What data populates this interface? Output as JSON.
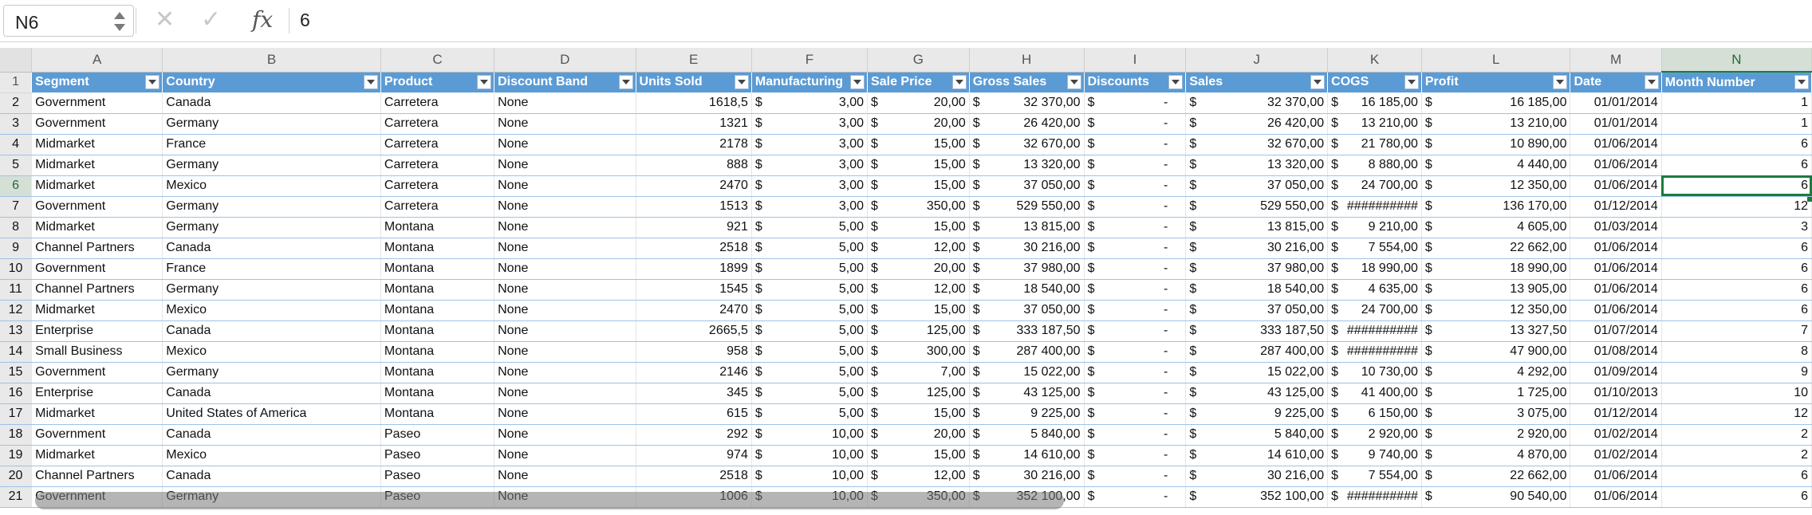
{
  "formula_bar": {
    "name_box": "N6",
    "cancel_icon": "✕",
    "enter_icon": "✓",
    "fx_label": "fx",
    "formula": "6"
  },
  "columns": [
    "A",
    "B",
    "C",
    "D",
    "E",
    "F",
    "G",
    "H",
    "I",
    "J",
    "K",
    "L",
    "M",
    "N"
  ],
  "headers": [
    "Segment",
    "Country",
    "Product",
    "Discount Band",
    "Units Sold",
    "Manufacturing",
    "Sale Price",
    "Gross Sales",
    "Discounts",
    "Sales",
    "COGS",
    "Profit",
    "Date",
    "Month Number"
  ],
  "header_row_number": "1",
  "rows": [
    {
      "n": "2",
      "cells": [
        "Government",
        "Canada",
        "Carretera",
        "None",
        "1618,5",
        "3,00",
        "20,00",
        "32 370,00",
        "-",
        "32 370,00",
        "16 185,00",
        "16 185,00",
        "01/01/2014",
        "1"
      ]
    },
    {
      "n": "3",
      "cells": [
        "Government",
        "Germany",
        "Carretera",
        "None",
        "1321",
        "3,00",
        "20,00",
        "26 420,00",
        "-",
        "26 420,00",
        "13 210,00",
        "13 210,00",
        "01/01/2014",
        "1"
      ]
    },
    {
      "n": "4",
      "cells": [
        "Midmarket",
        "France",
        "Carretera",
        "None",
        "2178",
        "3,00",
        "15,00",
        "32 670,00",
        "-",
        "32 670,00",
        "21 780,00",
        "10 890,00",
        "01/06/2014",
        "6"
      ]
    },
    {
      "n": "5",
      "cells": [
        "Midmarket",
        "Germany",
        "Carretera",
        "None",
        "888",
        "3,00",
        "15,00",
        "13 320,00",
        "-",
        "13 320,00",
        "8 880,00",
        "4 440,00",
        "01/06/2014",
        "6"
      ]
    },
    {
      "n": "6",
      "cells": [
        "Midmarket",
        "Mexico",
        "Carretera",
        "None",
        "2470",
        "3,00",
        "15,00",
        "37 050,00",
        "-",
        "37 050,00",
        "24 700,00",
        "12 350,00",
        "01/06/2014",
        "6"
      ]
    },
    {
      "n": "7",
      "cells": [
        "Government",
        "Germany",
        "Carretera",
        "None",
        "1513",
        "3,00",
        "350,00",
        "529 550,00",
        "-",
        "529 550,00",
        "##########",
        "136 170,00",
        "01/12/2014",
        "12"
      ]
    },
    {
      "n": "8",
      "cells": [
        "Midmarket",
        "Germany",
        "Montana",
        "None",
        "921",
        "5,00",
        "15,00",
        "13 815,00",
        "-",
        "13 815,00",
        "9 210,00",
        "4 605,00",
        "01/03/2014",
        "3"
      ]
    },
    {
      "n": "9",
      "cells": [
        "Channel Partners",
        "Canada",
        "Montana",
        "None",
        "2518",
        "5,00",
        "12,00",
        "30 216,00",
        "-",
        "30 216,00",
        "7 554,00",
        "22 662,00",
        "01/06/2014",
        "6"
      ]
    },
    {
      "n": "10",
      "cells": [
        "Government",
        "France",
        "Montana",
        "None",
        "1899",
        "5,00",
        "20,00",
        "37 980,00",
        "-",
        "37 980,00",
        "18 990,00",
        "18 990,00",
        "01/06/2014",
        "6"
      ]
    },
    {
      "n": "11",
      "cells": [
        "Channel Partners",
        "Germany",
        "Montana",
        "None",
        "1545",
        "5,00",
        "12,00",
        "18 540,00",
        "-",
        "18 540,00",
        "4 635,00",
        "13 905,00",
        "01/06/2014",
        "6"
      ]
    },
    {
      "n": "12",
      "cells": [
        "Midmarket",
        "Mexico",
        "Montana",
        "None",
        "2470",
        "5,00",
        "15,00",
        "37 050,00",
        "-",
        "37 050,00",
        "24 700,00",
        "12 350,00",
        "01/06/2014",
        "6"
      ]
    },
    {
      "n": "13",
      "cells": [
        "Enterprise",
        "Canada",
        "Montana",
        "None",
        "2665,5",
        "5,00",
        "125,00",
        "333 187,50",
        "-",
        "333 187,50",
        "##########",
        "13 327,50",
        "01/07/2014",
        "7"
      ]
    },
    {
      "n": "14",
      "cells": [
        "Small Business",
        "Mexico",
        "Montana",
        "None",
        "958",
        "5,00",
        "300,00",
        "287 400,00",
        "-",
        "287 400,00",
        "##########",
        "47 900,00",
        "01/08/2014",
        "8"
      ]
    },
    {
      "n": "15",
      "cells": [
        "Government",
        "Germany",
        "Montana",
        "None",
        "2146",
        "5,00",
        "7,00",
        "15 022,00",
        "-",
        "15 022,00",
        "10 730,00",
        "4 292,00",
        "01/09/2014",
        "9"
      ]
    },
    {
      "n": "16",
      "cells": [
        "Enterprise",
        "Canada",
        "Montana",
        "None",
        "345",
        "5,00",
        "125,00",
        "43 125,00",
        "-",
        "43 125,00",
        "41 400,00",
        "1 725,00",
        "01/10/2013",
        "10"
      ]
    },
    {
      "n": "17",
      "cells": [
        "Midmarket",
        "United States of America",
        "Montana",
        "None",
        "615",
        "5,00",
        "15,00",
        "9 225,00",
        "-",
        "9 225,00",
        "6 150,00",
        "3 075,00",
        "01/12/2014",
        "12"
      ]
    },
    {
      "n": "18",
      "cells": [
        "Government",
        "Canada",
        "Paseo",
        "None",
        "292",
        "10,00",
        "20,00",
        "5 840,00",
        "-",
        "5 840,00",
        "2 920,00",
        "2 920,00",
        "01/02/2014",
        "2"
      ]
    },
    {
      "n": "19",
      "cells": [
        "Midmarket",
        "Mexico",
        "Paseo",
        "None",
        "974",
        "10,00",
        "15,00",
        "14 610,00",
        "-",
        "14 610,00",
        "9 740,00",
        "4 870,00",
        "01/02/2014",
        "2"
      ]
    },
    {
      "n": "20",
      "cells": [
        "Channel Partners",
        "Canada",
        "Paseo",
        "None",
        "2518",
        "10,00",
        "12,00",
        "30 216,00",
        "-",
        "30 216,00",
        "7 554,00",
        "22 662,00",
        "01/06/2014",
        "6"
      ]
    },
    {
      "n": "21",
      "cells": [
        "Government",
        "Germany",
        "Paseo",
        "None",
        "1006",
        "10,00",
        "350,00",
        "352 100,00",
        "-",
        "352 100,00",
        "##########",
        "90 540,00",
        "01/06/2014",
        "6"
      ]
    }
  ],
  "currency_symbol": "$",
  "selected": {
    "col": "N",
    "row": "6"
  },
  "colors": {
    "header_fill": "#5b9bd5",
    "selection": "#1e7a3e"
  }
}
